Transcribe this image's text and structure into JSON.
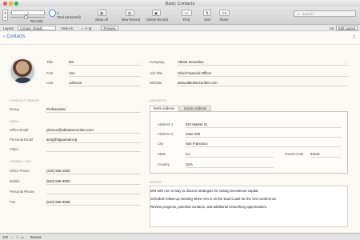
{
  "window": {
    "title": "Basic Contacts"
  },
  "toolbar": {
    "record_value": "1",
    "total_text": "Total (Unsorted)",
    "total_count": "1",
    "records_label": "Records",
    "show_all_label": "Show All",
    "new_record_label": "New Record",
    "delete_record_label": "Delete Record",
    "find_label": "Find",
    "sort_label": "Sort",
    "share_label": "Share",
    "search_placeholder": "Search"
  },
  "layout_bar": {
    "layout_label": "Layout:",
    "layout_value": "Contact Details",
    "view_as_label": "View As:",
    "preview_label": "Preview",
    "format_label": "Aa",
    "edit_layout_label": "Edit Layout"
  },
  "header": {
    "back_label": "Contacts"
  },
  "person": {
    "title_label": "Title",
    "title_value": "Ms.",
    "first_label": "First",
    "first_value": "Ann",
    "last_label": "Last",
    "last_value": "Johnson",
    "company_label": "Company",
    "company_value": "Abbott Securities",
    "job_title_label": "Job Title",
    "job_title_value": "Chief Financial Officer",
    "website_label": "Website",
    "website_value": "www.abbottsecurities.com"
  },
  "contact_group": {
    "section_label": "CONTACT GROUP",
    "group_label": "Group",
    "group_value": "Professional",
    "email_section": "EMAIL",
    "office_email_label": "Office Email",
    "office_email_value": "johnson@abbottsecurities.com",
    "personal_email_label": "Personal Email",
    "personal_email_value": "annj@hippomail.org",
    "video_label": "Video",
    "video_value": "",
    "phone_section": "PHONE / FAX",
    "office_phone_label": "Office Phone",
    "office_phone_value": "(415) 555-1000",
    "mobile_label": "Mobile",
    "mobile_value": "(510) 555-9090",
    "personal_phone_label": "Personal Phone",
    "personal_phone_value": "",
    "fax_label": "Fax",
    "fax_value": "(510) 555-9098"
  },
  "address": {
    "section_label": "ADDRESS",
    "tabs": [
      {
        "label": "Work Address"
      },
      {
        "label": "Home Address"
      }
    ],
    "address1_label": "Address 1",
    "address1_value": "522 Market St.",
    "address2_label": "Address 2",
    "address2_value": "Suite 200",
    "city_label": "City",
    "city_value": "San Francisco",
    "state_label": "State",
    "state_value": "CA",
    "postal_label": "Postal Code",
    "postal_value": "94121",
    "country_label": "Country",
    "country_value": "USA"
  },
  "notes": {
    "section_label": "NOTES",
    "lines": [
      "Met with Ann in May to discuss strategies for raising investment capital.",
      "Schedule follow-up meeting when Ann is on the East Coast for the CIO conference.",
      "Review progress, potential contacts, and additional networking opportunities."
    ]
  },
  "statusbar": {
    "zoom": "100",
    "mode": "Browse"
  },
  "colors": {
    "accent": "#2a6fb8",
    "background": "#faf9f3"
  }
}
